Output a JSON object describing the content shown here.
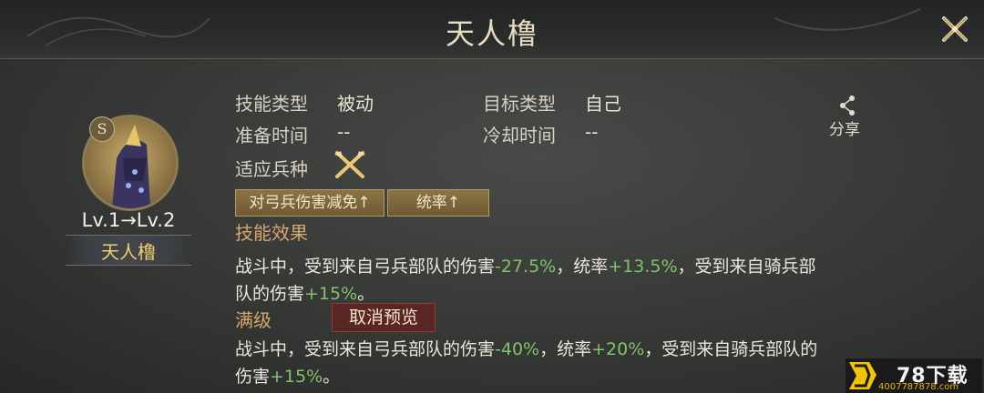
{
  "title": "天人橹",
  "hero": {
    "badge": "S",
    "level": "Lv.1→Lv.2",
    "name": "天人橹"
  },
  "info": {
    "skill_type_label": "技能类型",
    "skill_type_value": "被动",
    "target_type_label": "目标类型",
    "target_type_value": "自己",
    "prep_time_label": "准备时间",
    "prep_time_value": "--",
    "cooldown_label": "冷却时间",
    "cooldown_value": "--",
    "troop_label": "适应兵种"
  },
  "share_label": "分享",
  "tags": [
    "对弓兵伤害减免↑",
    "统率↑"
  ],
  "effect": {
    "heading": "技能效果",
    "line1_a": "战斗中，受到来自弓兵部队的伤害",
    "line1_v1": "-27.5%",
    "line1_b": "，统率",
    "line1_v2": "+13.5%",
    "line1_c": "，受到来自骑兵部",
    "line2_a": "队的伤害",
    "line2_v": "+15%",
    "line2_b": "。"
  },
  "max": {
    "heading": "满级",
    "cancel_button": "取消预览",
    "line1_a": "战斗中，受到来自弓兵部队的伤害",
    "line1_v1": "-40%",
    "line1_b": "，统率",
    "line1_v2": "+20%",
    "line1_c": "，受到来自骑兵部队的",
    "line2_a": "伤害",
    "line2_v": "+15%",
    "line2_b": "。"
  },
  "watermark": {
    "brand": "78下载",
    "url": "4007787878.com"
  },
  "colors": {
    "gain": "#7fc36b",
    "section": "#d6a76a",
    "hero_name": "#f0cf6a"
  }
}
